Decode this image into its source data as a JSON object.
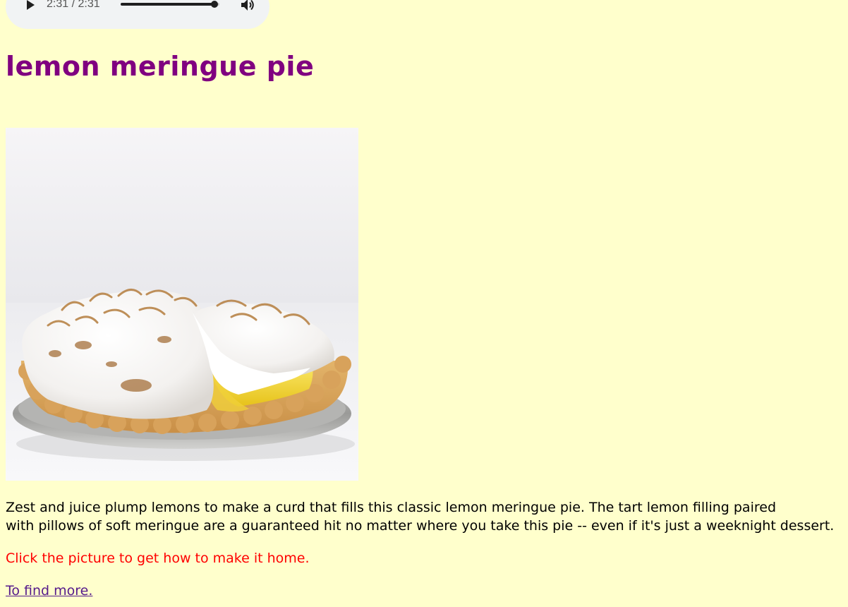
{
  "audio": {
    "time_text": "2:31 / 2:31",
    "progress": 0.95,
    "play_icon": "play-icon",
    "volume_icon": "volume-icon"
  },
  "title": "lemon meringue pie",
  "image": {
    "alt": "lemon meringue pie"
  },
  "description": {
    "line1": "Zest and juice plump lemons to make a curd that fills this classic lemon meringue pie. The tart lemon filling paired",
    "line2": "with pillows of soft meringue are a guaranteed hit no matter where you take this pie -- even if it's just a weeknight dessert."
  },
  "note": "Click the picture to get how to make it home.",
  "more_link": "To find more.",
  "colors": {
    "background": "#ffffcc",
    "title": "#800080",
    "note": "#ff0000",
    "link": "#551a8b"
  }
}
